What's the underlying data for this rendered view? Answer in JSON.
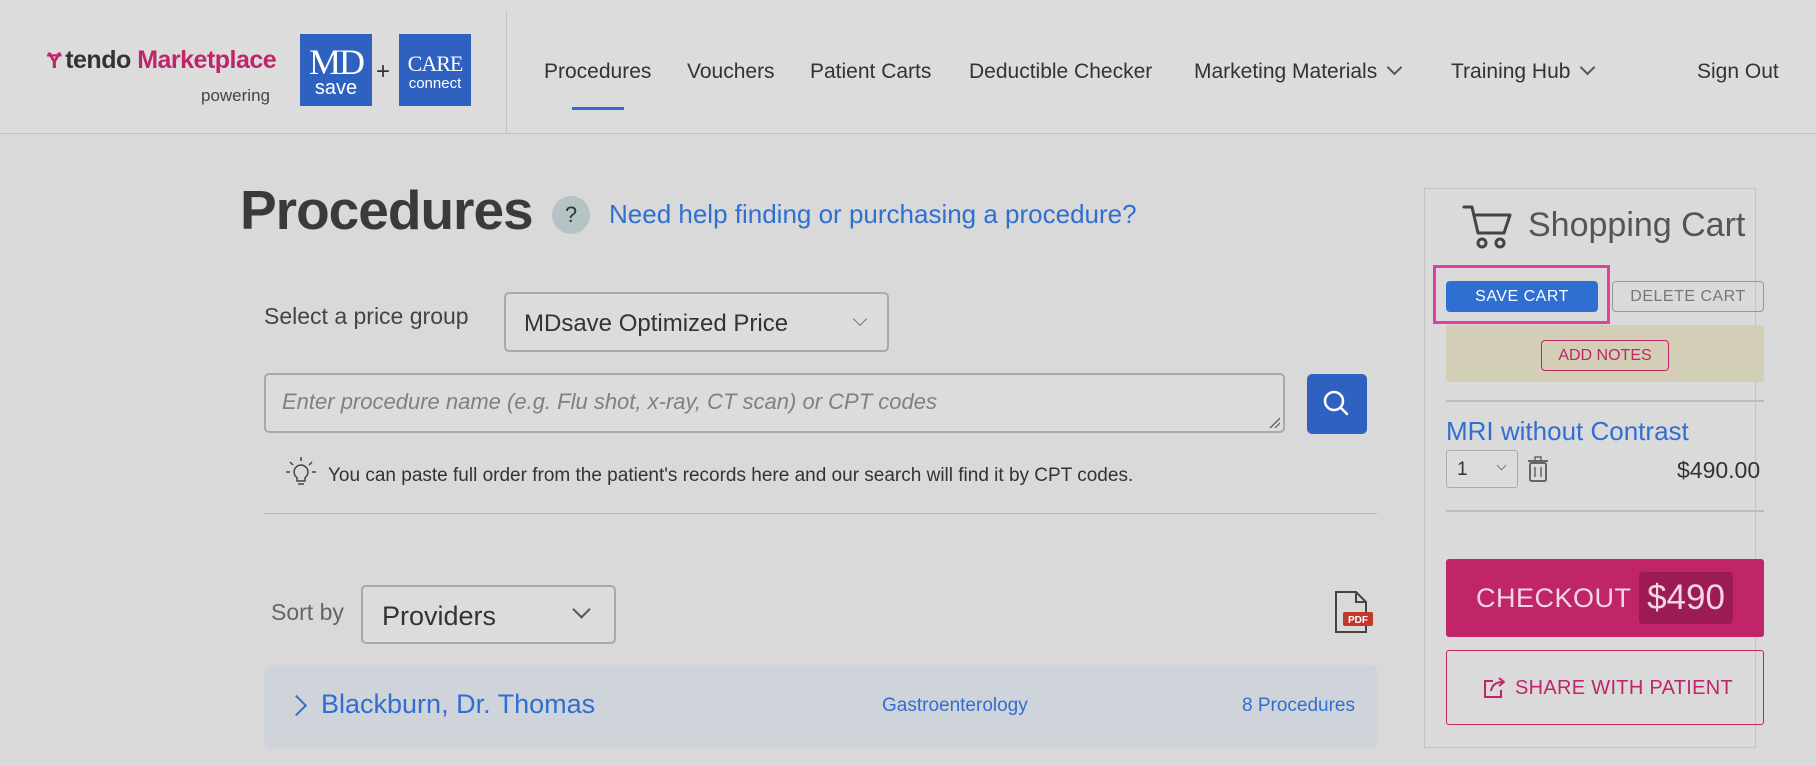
{
  "header": {
    "brand_word": "tendo",
    "brand_marketplace": "Marketplace",
    "powering": "powering",
    "md_big": "MD",
    "md_small": "save",
    "plus": "+",
    "care_big": "CARE",
    "care_small": "connect",
    "nav": {
      "procedures": "Procedures",
      "vouchers": "Vouchers",
      "patient_carts": "Patient Carts",
      "deductible_checker": "Deductible Checker",
      "marketing_materials": "Marketing Materials",
      "training_hub": "Training Hub",
      "sign_out": "Sign Out"
    },
    "active_nav": "Procedures"
  },
  "main": {
    "title": "Procedures",
    "help_icon": "?",
    "help_link": "Need help finding or purchasing a procedure?",
    "price_group_label": "Select a price group",
    "price_group_value": "MDsave Optimized Price",
    "search_placeholder": "Enter procedure name (e.g. Flu shot, x-ray, CT scan) or CPT codes",
    "search_value": "",
    "tip": "You can paste full order from the patient's records here and our search will find it by CPT codes.",
    "sort_label": "Sort by",
    "sort_value": "Providers",
    "pdf_label": "PDF",
    "providers": [
      {
        "name": "Blackburn, Dr. Thomas",
        "specialty": "Gastroenterology",
        "count": "8 Procedures"
      }
    ]
  },
  "cart": {
    "title": "Shopping Cart",
    "save_label": "SAVE CART",
    "delete_label": "DELETE CART",
    "notes_label": "ADD NOTES",
    "items": [
      {
        "name": "MRI without Contrast",
        "qty": "1",
        "price": "$490.00"
      }
    ],
    "checkout_label": "CHECKOUT",
    "checkout_amount": "$490",
    "share_label": "SHARE WITH PATIENT"
  },
  "colors": {
    "brand_pink": "#c0256a",
    "brand_blue": "#2f62c0",
    "link_blue": "#2f6fd2",
    "highlight": "#e33fa3"
  },
  "icons": [
    "tendo-logo-icon",
    "help-icon",
    "search-icon",
    "lightbulb-icon",
    "pdf-icon",
    "chevron-right-icon",
    "cart-icon",
    "trash-icon",
    "share-icon",
    "chevron-down-icon"
  ]
}
